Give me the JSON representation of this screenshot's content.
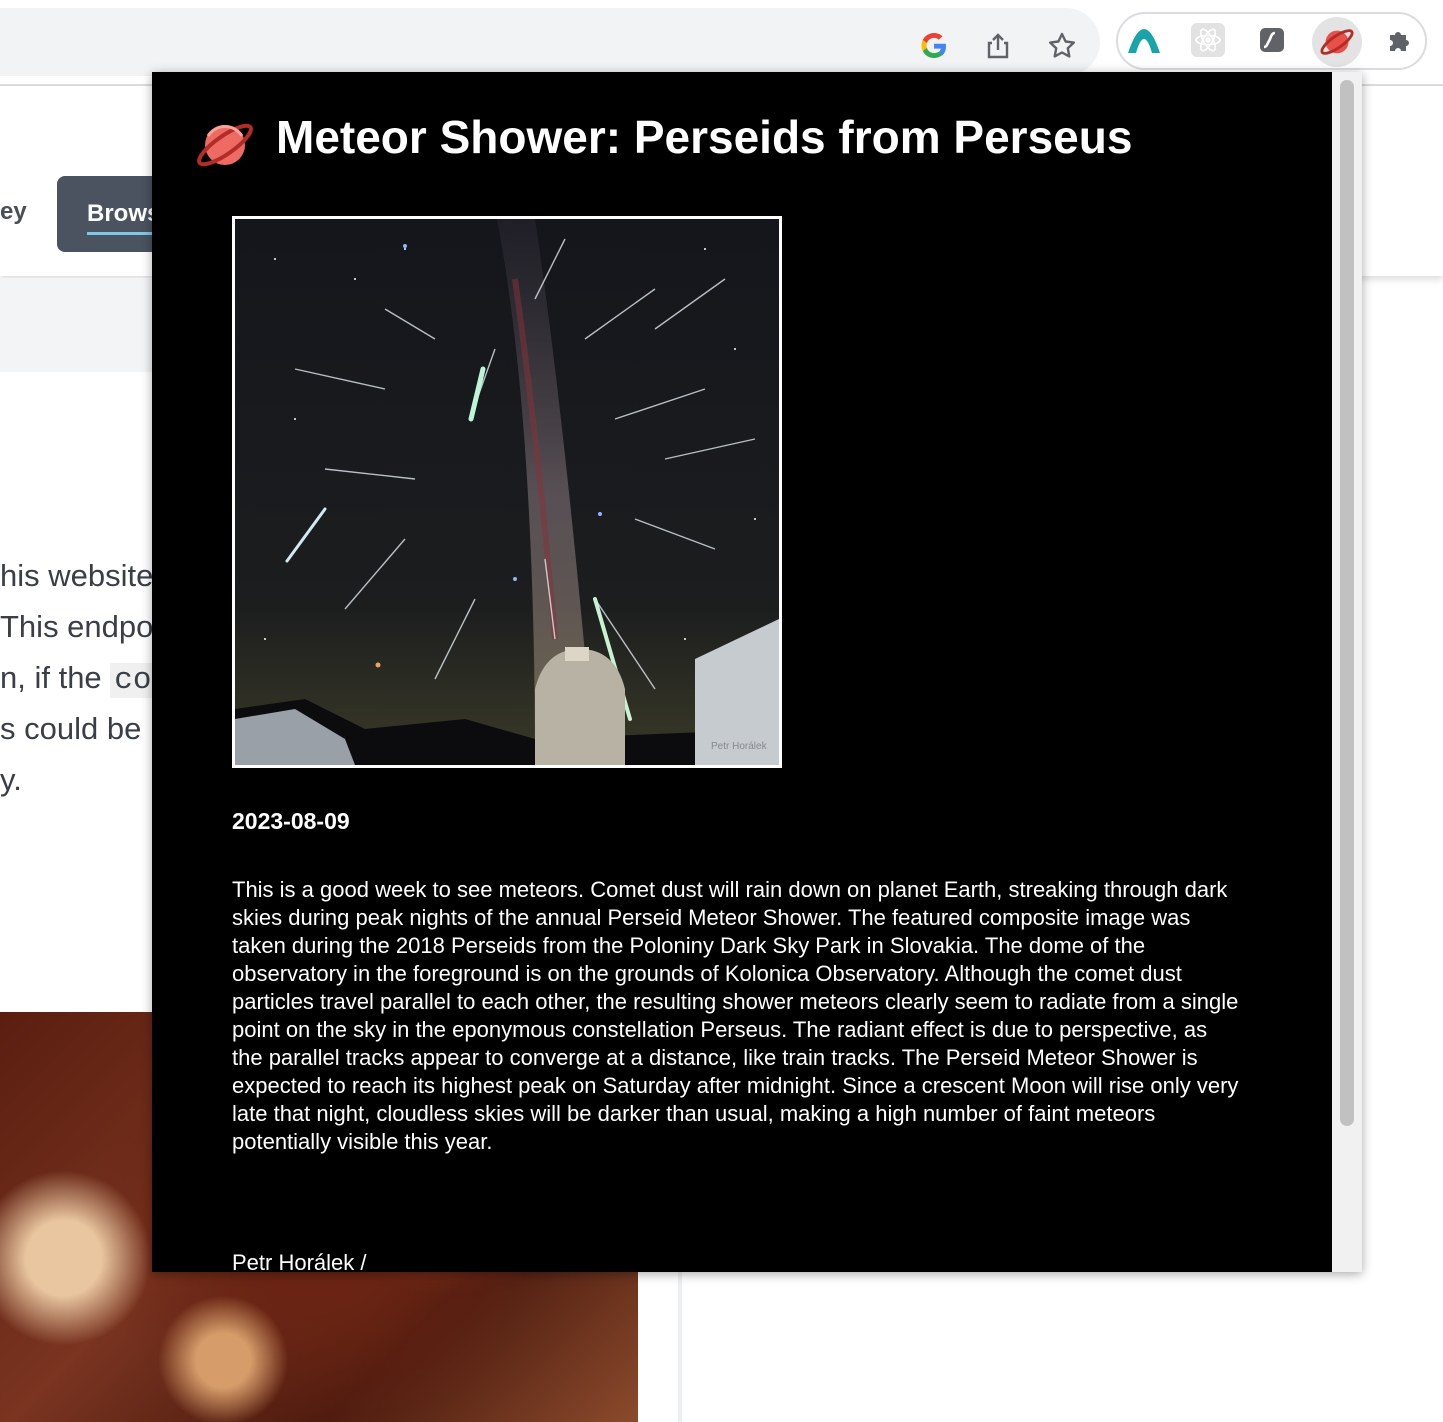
{
  "browser": {
    "toolbar_icons": [
      "google-icon",
      "share-icon",
      "bookmark-star-icon"
    ],
    "extensions": [
      "mountain-extension-icon",
      "react-devtools-icon",
      "script-extension-icon",
      "planet-extension-icon",
      "puzzle-extensions-icon"
    ],
    "active_extension": "planet-extension-icon"
  },
  "background_page": {
    "nav_prev_fragment": "ey",
    "nav_active_fragment": "Brows",
    "text_lines": [
      "his website",
      "This endpo",
      "n, if the ",
      "s could be ",
      "y."
    ],
    "code_fragment": "cor"
  },
  "popup": {
    "title": "Meteor Shower: Perseids from Perseus",
    "image_watermark": "Petr Horálek",
    "date": "2023-08-09",
    "description": "This is a good week to see meteors. Comet dust will rain down on planet Earth, streaking through dark skies during peak nights of the annual Perseid Meteor Shower. The featured composite image was taken during the 2018 Perseids from the Poloniny Dark Sky Park in Slovakia. The dome of the observatory in the foreground is on the grounds of Kolonica Observatory. Although the comet dust particles travel parallel to each other, the resulting shower meteors clearly seem to radiate from a single point on the sky in the eponymous constellation Perseus. The radiant effect is due to perspective, as the parallel tracks appear to converge at a distance, like train tracks. The Perseid Meteor Shower is expected to reach its highest peak on Saturday after midnight. Since a crescent Moon will rise only very late that night, cloudless skies will be darker than usual, making a high number of faint meteors potentially visible this year.",
    "credit": "Petr Horálek /"
  },
  "colors": {
    "popup_bg": "#000000",
    "planet_accent": "#e8504a",
    "nav_active_bg": "#4b5260"
  }
}
